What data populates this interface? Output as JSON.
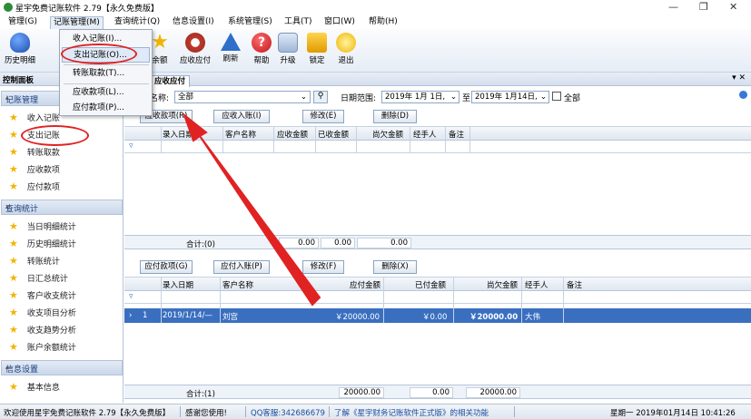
{
  "window": {
    "title": "星宇免费记账软件 2.79【永久免费版】",
    "controls": [
      "—",
      "❐",
      "✕"
    ]
  },
  "menubar": {
    "items": [
      "管理(G)",
      "记账管理(M)",
      "查询统计(Q)",
      "信息设置(I)",
      "系统管理(S)",
      "工具(T)",
      "窗口(W)",
      "帮助(H)"
    ]
  },
  "dropdown": {
    "items": [
      "收入记账(I)...",
      "支出记账(O)...",
      "转账取款(T)...",
      "应收款项(L)...",
      "应付款项(P)..."
    ]
  },
  "toolbar": {
    "items": [
      {
        "label": "历史明细",
        "icon": "history-icon"
      },
      {
        "label": "余额",
        "icon": "balance-icon"
      },
      {
        "label": "应收应付",
        "icon": "receivable-icon"
      },
      {
        "label": "刷新",
        "icon": "refresh-icon"
      },
      {
        "label": "帮助",
        "icon": "help-icon"
      },
      {
        "label": "升级",
        "icon": "upgrade-icon"
      },
      {
        "label": "锁定",
        "icon": "lock-icon"
      },
      {
        "label": "退出",
        "icon": "exit-icon"
      }
    ]
  },
  "panel": {
    "title": "控制面板",
    "close": "▾ ✕"
  },
  "sidebar": {
    "groups": [
      {
        "title": "记账管理",
        "items": [
          "收入记账",
          "支出记账",
          "转账取款",
          "应收款项",
          "应付款项"
        ]
      },
      {
        "title": "查询统计",
        "items": [
          "当日明细统计",
          "历史明细统计",
          "转账统计",
          "日汇总统计",
          "客户收支统计",
          "收支项目分析",
          "收支趋势分析",
          "账户余额统计"
        ]
      },
      {
        "title": "信息设置",
        "items": [
          "基本信息"
        ]
      }
    ]
  },
  "tabs": [
    "应收应付"
  ],
  "filter": {
    "name_label": "名称:",
    "name_value": "全部",
    "date_label": "日期范围:",
    "date_from": "2019年 1月 1日,",
    "to": "至",
    "date_to": "2019年 1月14日,",
    "all_label": "全部"
  },
  "receivable": {
    "buttons": [
      "应收款项(R)",
      "应收入账(I)",
      "修改(E)",
      "删除(D)"
    ],
    "columns": [
      "录入日期",
      "客户名称",
      "应收金额",
      "已收金额",
      "尚欠金额",
      "经手人",
      "备注"
    ],
    "footer": {
      "label": "合计:(0)",
      "values": [
        "0.00",
        "0.00",
        "0.00"
      ]
    }
  },
  "payable": {
    "buttons": [
      "应付款项(G)",
      "应付入账(P)",
      "修改(F)",
      "删除(X)"
    ],
    "columns": [
      "录入日期",
      "客户名称",
      "应付金额",
      "已付金额",
      "尚欠金额",
      "经手人",
      "备注"
    ],
    "rows": [
      {
        "no": "1",
        "date": "2019/1/14/—",
        "customer": "刘宫",
        "payable": "￥20000.00",
        "paid": "￥0.00",
        "owed": "￥20000.00",
        "handler": "大伟",
        "note": ""
      }
    ],
    "footer": {
      "label": "合计:(1)",
      "values": [
        "20000.00",
        "0.00",
        "20000.00"
      ]
    }
  },
  "status": {
    "welcome": "欢迎使用星宇免费记账软件 2.79【永久免费版】",
    "thanks": "感谢您使用!",
    "qq": "QQ客服:342686679",
    "link": "了解《星宇财务记账软件正式版》的相关功能",
    "datetime": "星期一 2019年01月14日 10:41:26"
  },
  "colors": {
    "accent": "#3a6fc0",
    "highlight": "#e02222"
  }
}
